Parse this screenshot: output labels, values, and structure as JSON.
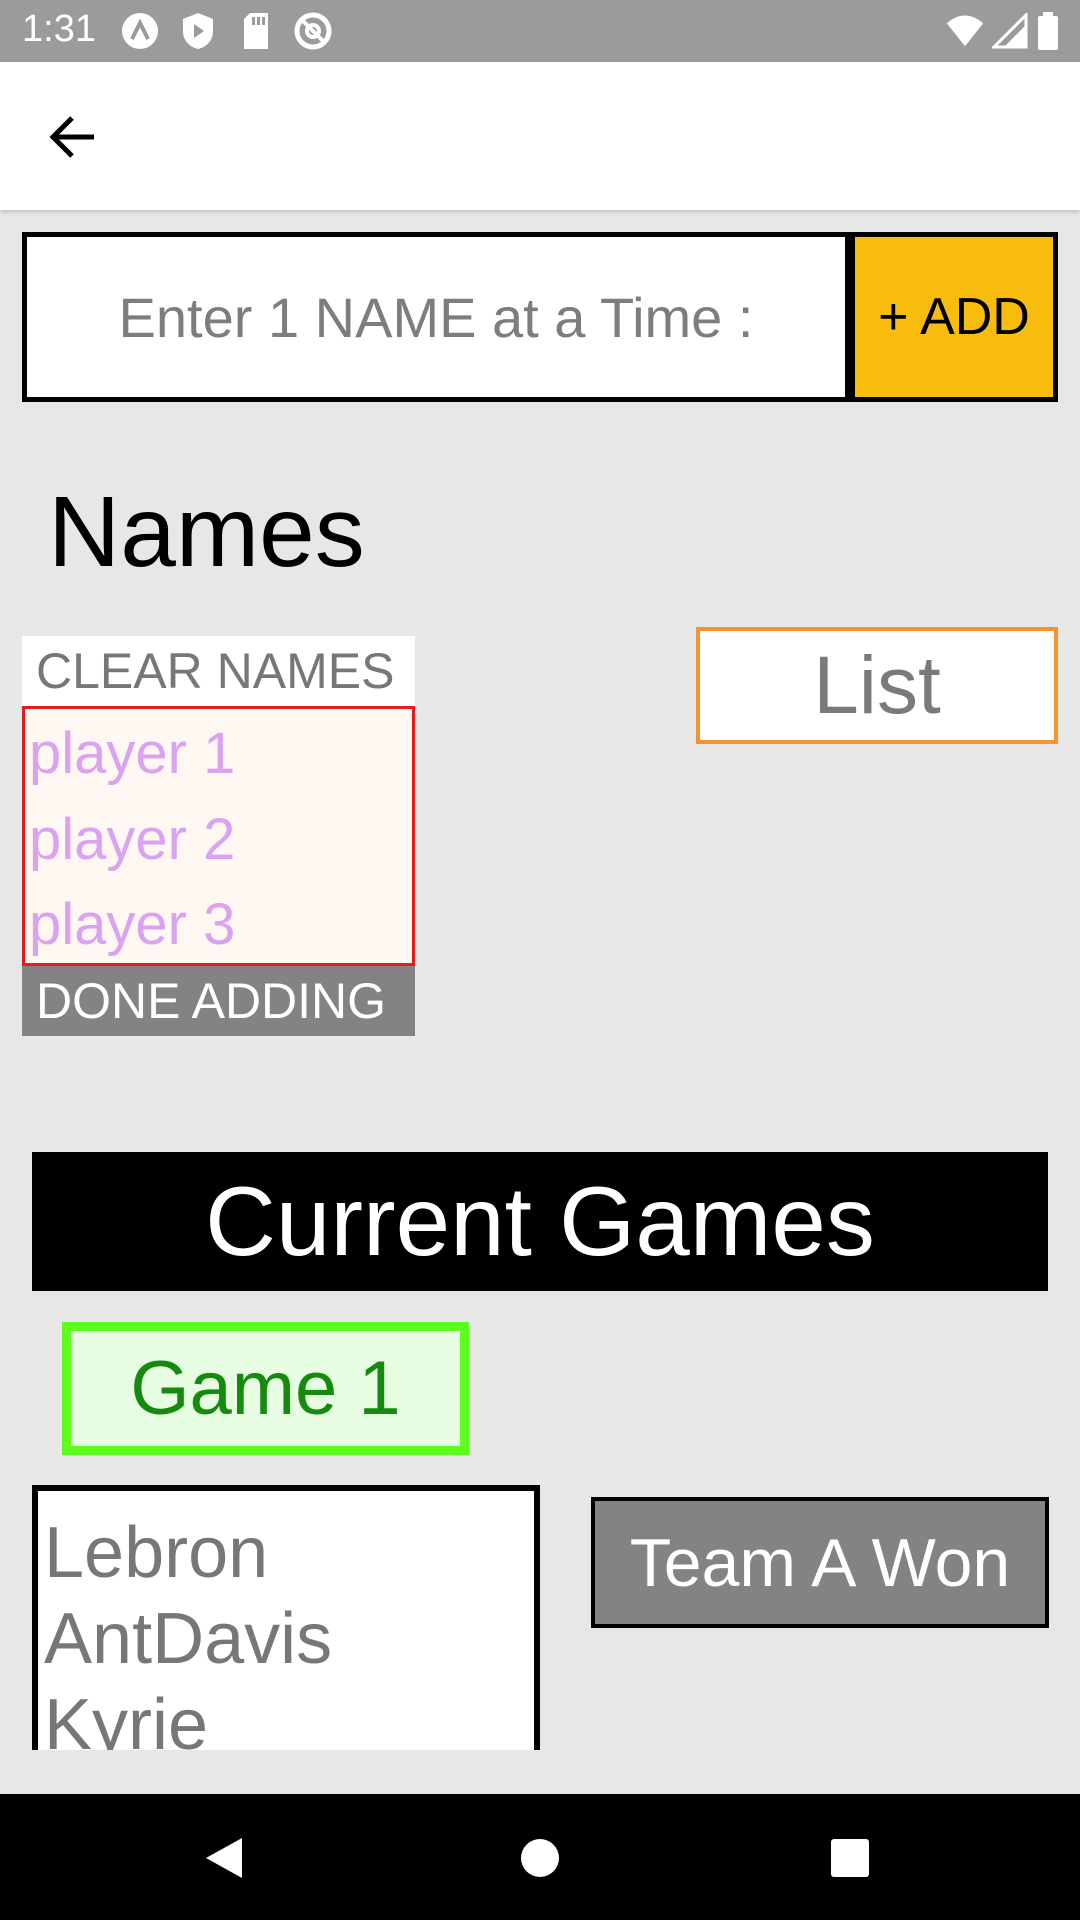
{
  "status_bar": {
    "time": "1:31",
    "icons_left": [
      "autodesk-icon",
      "shield-play-icon",
      "sd-card-icon",
      "no-disturb-icon"
    ],
    "icons_right": [
      "wifi-icon",
      "signal-icon",
      "battery-icon"
    ]
  },
  "input": {
    "placeholder": "Enter 1 NAME at a Time :",
    "value": ""
  },
  "add_button": "+ ADD",
  "names_title": "Names",
  "clear_button": "CLEAR NAMES",
  "players": [
    "player 1",
    "player 2",
    "player 3"
  ],
  "done_button": "DONE ADDING",
  "list_button": "List",
  "games_header": "Current Games",
  "game_button": "Game 1",
  "team_members": [
    "Lebron",
    "AntDavis",
    "Kyrie"
  ],
  "team_won_button": "Team A Won",
  "colors": {
    "add_button": "#f8bc0c",
    "list_border": "#f8922c",
    "game_border": "#5cff1b",
    "game_text": "#16890f",
    "player_text": "#d9a3f2",
    "names_border": "#e21d1d"
  }
}
